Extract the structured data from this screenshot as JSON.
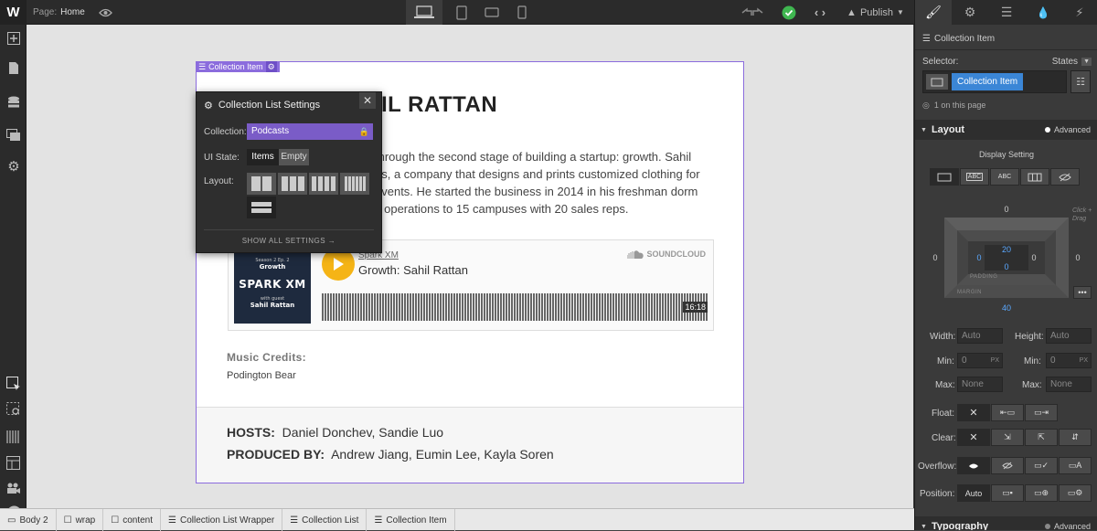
{
  "topbar": {
    "page_label": "Page:",
    "page_name": "Home",
    "publish_label": "Publish"
  },
  "page": {
    "heading": "IL RATTAN",
    "paragraph_lines": [
      "through the second stage of building a startup: growth. Sahil",
      "us, a company that designs and prints customized clothing for",
      "events. He started the business in 2014 in his freshman dorm",
      "s operations to 15 campuses with 20 sales reps."
    ],
    "player": {
      "artist": "Spark XM",
      "track": "Growth: Sahil Rattan",
      "duration": "16:18",
      "soundcloud": "SOUNDCLOUD",
      "art_top": "Season 2 Ep. 2",
      "art_title": "Growth",
      "art_brand": "SPARK XM",
      "art_with": "with guest",
      "art_guest": "Sahil Rattan"
    },
    "credits_label": "Music Credits:",
    "credits_value": "Podington Bear",
    "hosts_label": "HOSTS:",
    "hosts_value": "Daniel Donchev, Sandie Luo",
    "produced_label": "PRODUCED BY:",
    "produced_value": "Andrew Jiang, Eumin Lee, Kayla Soren"
  },
  "selection_tag": "Collection Item",
  "modal": {
    "title": "Collection List Settings",
    "collection_label": "Collection:",
    "collection_value": "Podcasts",
    "ui_state_label": "UI State:",
    "state_items": "Items",
    "state_empty": "Empty",
    "layout_label": "Layout:",
    "show_all": "SHOW ALL SETTINGS →"
  },
  "panel": {
    "element_name": "Collection Item",
    "selector_label": "Selector:",
    "states_label": "States",
    "selector_chip": "Collection Item",
    "on_page": "1 on this page",
    "layout_title": "Layout",
    "advanced": "Advanced",
    "display_setting": "Display Setting",
    "display_options": [
      "ABC",
      "ABC"
    ],
    "margin_top": "0",
    "margin_left": "0",
    "margin_right": "0",
    "margin_bottom": "40",
    "padding_top": "20",
    "padding_left": "0",
    "padding_right": "0",
    "padding_bottom": "0",
    "padding_label": "PADDING",
    "margin_label": "MARGIN",
    "click_drag": "Click + Drag",
    "width_label": "Width:",
    "height_label": "Height:",
    "min_label": "Min:",
    "max_label": "Max:",
    "auto": "Auto",
    "zero": "0",
    "none": "None",
    "px": "PX",
    "float_label": "Float:",
    "clear_label": "Clear:",
    "overflow_label": "Overflow:",
    "position_label": "Position:",
    "position_value": "Auto",
    "typography_title": "Typography"
  },
  "breadcrumbs": [
    "Body 2",
    "wrap",
    "content",
    "Collection List Wrapper",
    "Collection List",
    "Collection Item"
  ]
}
